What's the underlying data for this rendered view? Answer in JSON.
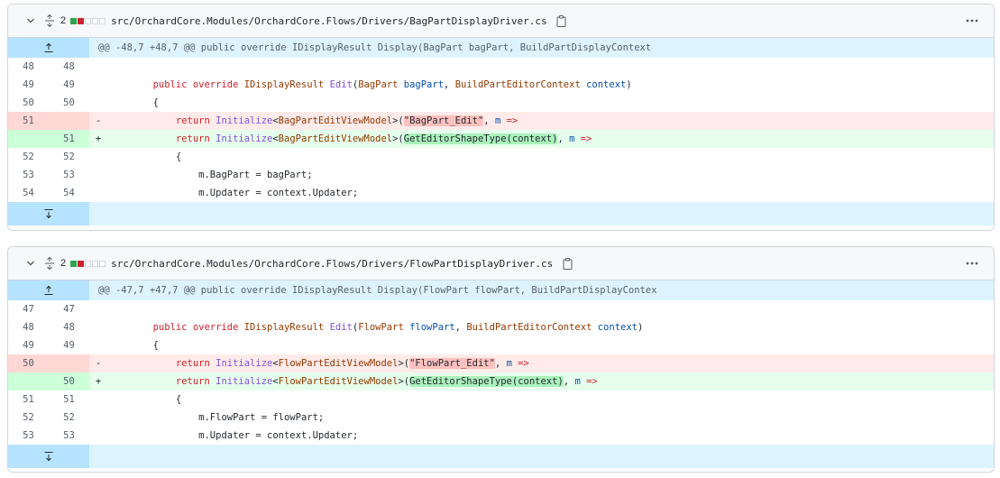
{
  "files": [
    {
      "additions_deletions": "2",
      "path": "src/OrchardCore.Modules/OrchardCore.Flows/Drivers/BagPartDisplayDriver.cs",
      "hunk": "@@ -48,7 +48,7 @@ public override IDisplayResult Display(BagPart bagPart, BuildPartDisplayContext",
      "lines": [
        {
          "type": "ctx",
          "old": "48",
          "new": "48",
          "sign": "",
          "code": ""
        },
        {
          "type": "ctx",
          "old": "49",
          "new": "49",
          "sign": "",
          "indent": "        ",
          "tokens": [
            [
              "kw",
              "public override "
            ],
            [
              "ty",
              "IDisplayResult "
            ],
            [
              "fn",
              "Edit"
            ],
            [
              "",
              "("
            ],
            [
              "ty",
              "BagPart "
            ],
            [
              "pm",
              "bagPart"
            ],
            [
              "",
              ", "
            ],
            [
              "ty",
              "BuildPartEditorContext "
            ],
            [
              "pm",
              "context"
            ],
            [
              "",
              ")"
            ]
          ]
        },
        {
          "type": "ctx",
          "old": "50",
          "new": "50",
          "sign": "",
          "indent": "        ",
          "tokens": [
            [
              "",
              "{"
            ]
          ]
        },
        {
          "type": "del",
          "old": "51",
          "new": "",
          "sign": "-",
          "indent": "            ",
          "tokens": [
            [
              "kw",
              "return "
            ],
            [
              "fn",
              "Initialize"
            ],
            [
              "",
              "<"
            ],
            [
              "ty",
              "BagPartEditViewModel"
            ],
            [
              "",
              ">("
            ],
            [
              "hl-del",
              "\"BagPart_Edit\""
            ],
            [
              "",
              ", "
            ],
            [
              "pm",
              "m"
            ],
            [
              "kw",
              " =>"
            ]
          ]
        },
        {
          "type": "add",
          "old": "",
          "new": "51",
          "sign": "+",
          "indent": "            ",
          "tokens": [
            [
              "kw",
              "return "
            ],
            [
              "fn",
              "Initialize"
            ],
            [
              "",
              "<"
            ],
            [
              "ty",
              "BagPartEditViewModel"
            ],
            [
              "",
              ">("
            ],
            [
              "hl-add",
              "GetEditorShapeType(context)"
            ],
            [
              "",
              ", "
            ],
            [
              "pm",
              "m"
            ],
            [
              "kw",
              " =>"
            ]
          ]
        },
        {
          "type": "ctx",
          "old": "52",
          "new": "52",
          "sign": "",
          "indent": "            ",
          "tokens": [
            [
              "",
              "{"
            ]
          ]
        },
        {
          "type": "ctx",
          "old": "53",
          "new": "53",
          "sign": "",
          "indent": "                ",
          "tokens": [
            [
              "",
              "m.BagPart = bagPart;"
            ]
          ]
        },
        {
          "type": "ctx",
          "old": "54",
          "new": "54",
          "sign": "",
          "indent": "                ",
          "tokens": [
            [
              "",
              "m.Updater = context.Updater;"
            ]
          ]
        }
      ]
    },
    {
      "additions_deletions": "2",
      "path": "src/OrchardCore.Modules/OrchardCore.Flows/Drivers/FlowPartDisplayDriver.cs",
      "hunk": "@@ -47,7 +47,7 @@ public override IDisplayResult Display(FlowPart flowPart, BuildPartDisplayContex",
      "lines": [
        {
          "type": "ctx",
          "old": "47",
          "new": "47",
          "sign": "",
          "code": ""
        },
        {
          "type": "ctx",
          "old": "48",
          "new": "48",
          "sign": "",
          "indent": "        ",
          "tokens": [
            [
              "kw",
              "public override "
            ],
            [
              "ty",
              "IDisplayResult "
            ],
            [
              "fn",
              "Edit"
            ],
            [
              "",
              "("
            ],
            [
              "ty",
              "FlowPart "
            ],
            [
              "pm",
              "flowPart"
            ],
            [
              "",
              ", "
            ],
            [
              "ty",
              "BuildPartEditorContext "
            ],
            [
              "pm",
              "context"
            ],
            [
              "",
              ")"
            ]
          ]
        },
        {
          "type": "ctx",
          "old": "49",
          "new": "49",
          "sign": "",
          "indent": "        ",
          "tokens": [
            [
              "",
              "{"
            ]
          ]
        },
        {
          "type": "del",
          "old": "50",
          "new": "",
          "sign": "-",
          "indent": "            ",
          "tokens": [
            [
              "kw",
              "return "
            ],
            [
              "fn",
              "Initialize"
            ],
            [
              "",
              "<"
            ],
            [
              "ty",
              "FlowPartEditViewModel"
            ],
            [
              "",
              ">("
            ],
            [
              "hl-del",
              "\"FlowPart_Edit\""
            ],
            [
              "",
              ", "
            ],
            [
              "pm",
              "m"
            ],
            [
              "kw",
              " =>"
            ]
          ]
        },
        {
          "type": "add",
          "old": "",
          "new": "50",
          "sign": "+",
          "indent": "            ",
          "tokens": [
            [
              "kw",
              "return "
            ],
            [
              "fn",
              "Initialize"
            ],
            [
              "",
              "<"
            ],
            [
              "ty",
              "FlowPartEditViewModel"
            ],
            [
              "",
              ">("
            ],
            [
              "hl-add",
              "GetEditorShapeType(context)"
            ],
            [
              "",
              ", "
            ],
            [
              "pm",
              "m"
            ],
            [
              "kw",
              " =>"
            ]
          ]
        },
        {
          "type": "ctx",
          "old": "51",
          "new": "51",
          "sign": "",
          "indent": "            ",
          "tokens": [
            [
              "",
              "{"
            ]
          ]
        },
        {
          "type": "ctx",
          "old": "52",
          "new": "52",
          "sign": "",
          "indent": "                ",
          "tokens": [
            [
              "",
              "m.FlowPart = flowPart;"
            ]
          ]
        },
        {
          "type": "ctx",
          "old": "53",
          "new": "53",
          "sign": "",
          "indent": "                ",
          "tokens": [
            [
              "",
              "m.Updater = context.Updater;"
            ]
          ]
        }
      ]
    }
  ]
}
